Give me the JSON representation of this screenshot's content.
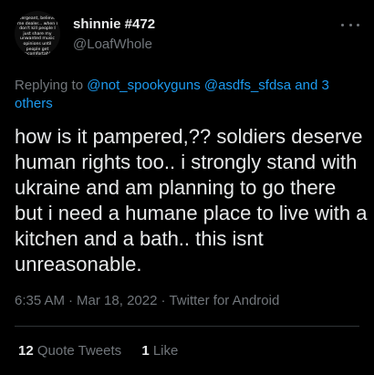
{
  "colors": {
    "background": "#000000",
    "text_primary": "#e7e9ea",
    "text_secondary": "#71767b",
    "link": "#1d9bf0",
    "divider": "#2f3336"
  },
  "author": {
    "avatar_text": "sergeant, believe me dealer... when I don't kill people I just share my unwanted music opinions until people get uncomfortable",
    "display_name": "shinnie #472",
    "handle": "@LoafWhole"
  },
  "more_icon": "more-horizontal-icon",
  "reply_context": {
    "prefix": "Replying to ",
    "mentions": "@not_spookyguns @asdfs_sfdsa and 3 others"
  },
  "tweet": {
    "text": "how is it pampered,?? soldiers deserve human rights too.. i strongly stand with ukraine and am planning to go there but i need a humane place to live with a kitchen and a bath.. this isnt unreasonable."
  },
  "meta": {
    "time": "6:35 AM",
    "separator": "·",
    "date": "Mar 18, 2022",
    "source": "Twitter for Android"
  },
  "stats": {
    "quote_tweets_count": "12",
    "quote_tweets_label": "Quote Tweets",
    "likes_count": "1",
    "likes_label": "Like"
  }
}
